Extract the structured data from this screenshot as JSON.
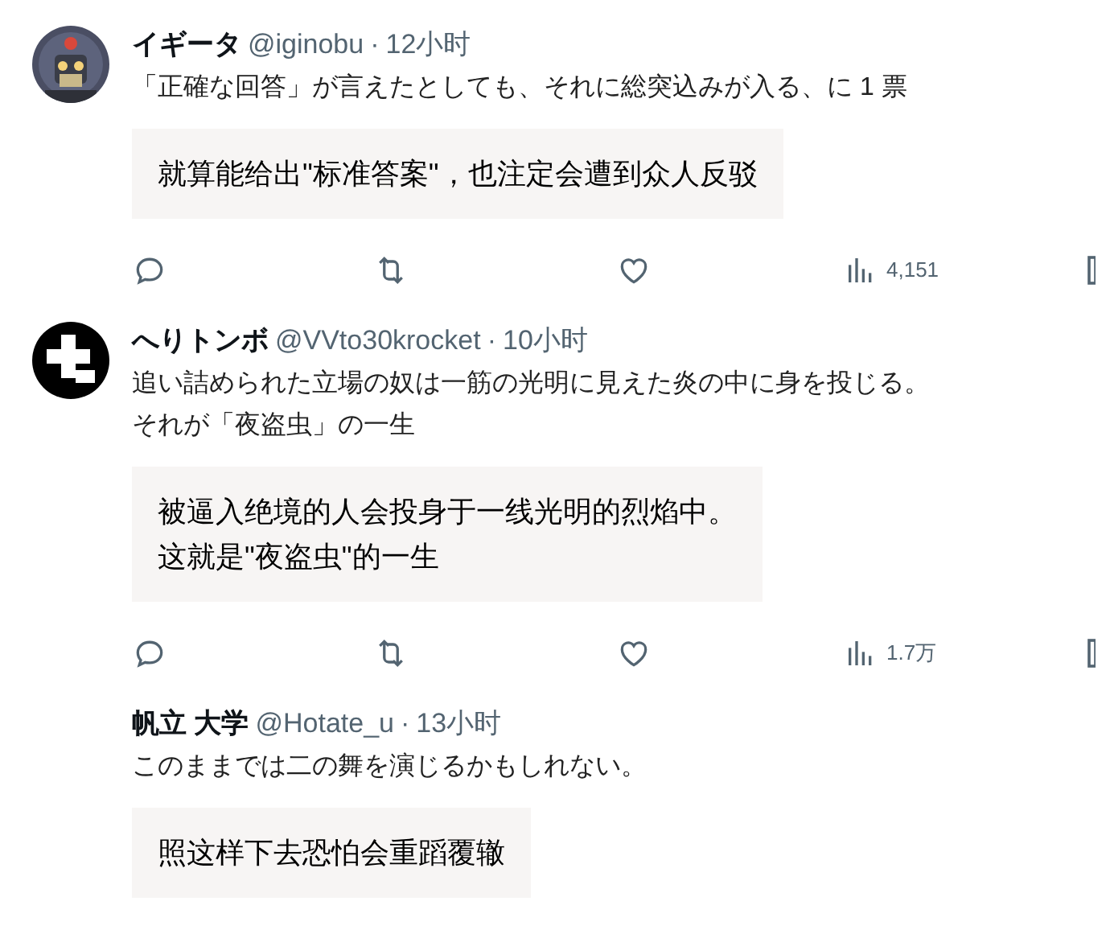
{
  "tweets": [
    {
      "avatar": {
        "kind": "picture"
      },
      "name": "イギータ",
      "handle": "@iginobu",
      "dot": "·",
      "time": "12小时",
      "text_lines": [
        "「正確な回答」が言えたとしても、それに総突込みが入る、に 1 票"
      ],
      "translation_lines": [
        "就算能给出\"标准答案\"，也注定会遭到众人反驳"
      ],
      "views": "4,151"
    },
    {
      "avatar": {
        "kind": "logo"
      },
      "name": "へりトンボ",
      "handle": "@VVto30krocket",
      "dot": "·",
      "time": "10小时",
      "text_lines": [
        "追い詰められた立場の奴は一筋の光明に見えた炎の中に身を投じる。",
        "それが「夜盗虫」の一生"
      ],
      "translation_lines": [
        "被逼入绝境的人会投身于一线光明的烈焰中。",
        "这就是\"夜盗虫\"的一生"
      ],
      "views": "1.7万"
    },
    {
      "name": "帆立 大学",
      "handle": "@Hotate_u",
      "dot": "·",
      "time": "13小时",
      "text_lines": [
        "このままでは二の舞を演じるかもしれない。"
      ],
      "translation_lines": [
        "照这样下去恐怕会重蹈覆辙"
      ]
    }
  ]
}
